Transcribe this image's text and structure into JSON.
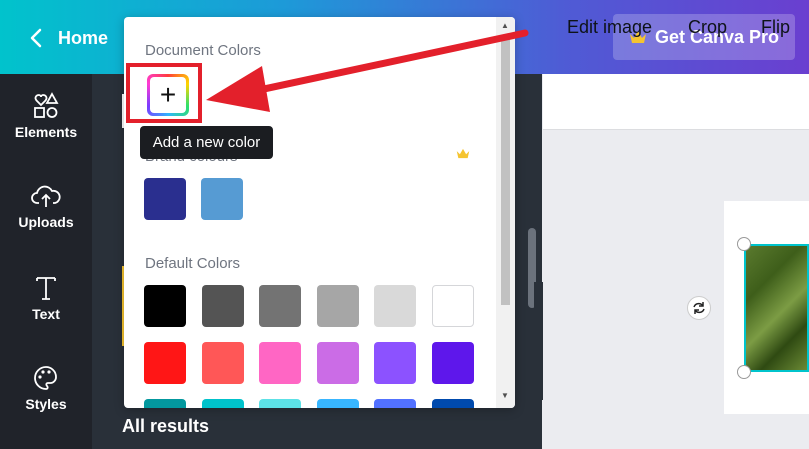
{
  "topbar": {
    "home_label": "Home",
    "pro_label": "Get Canva Pro"
  },
  "rail": {
    "items": [
      {
        "label": "Elements",
        "icon": "elements-icon"
      },
      {
        "label": "Uploads",
        "icon": "upload-cloud-icon"
      },
      {
        "label": "Text",
        "icon": "text-icon"
      },
      {
        "label": "Styles",
        "icon": "palette-icon"
      }
    ]
  },
  "panel": {
    "all_results": "All results"
  },
  "toolbar": {
    "edit_image": "Edit image",
    "crop": "Crop",
    "flip": "Flip"
  },
  "popup": {
    "document_colors_title": "Document Colors",
    "add_color_symbol": "+",
    "tooltip": "Add a new color",
    "brand_colors_title": "Brand colours",
    "brand_colors": [
      "#2a2f8f",
      "#569bd3"
    ],
    "default_colors_title": "Default Colors",
    "default_colors": [
      [
        "#000000",
        "#545454",
        "#737373",
        "#a6a6a6",
        "#d9d9d9",
        "#ffffff"
      ],
      [
        "#ff1616",
        "#ff5757",
        "#ff66c4",
        "#cb6ce6",
        "#8c52ff",
        "#5e17eb"
      ],
      [
        "#03989e",
        "#00c2cb",
        "#5ce1e6",
        "#38b6ff",
        "#5271ff",
        "#004aad"
      ]
    ]
  },
  "colors": {
    "annotation_red": "#e3202b",
    "rail_bg": "#20232a",
    "panel_bg": "#293039"
  }
}
